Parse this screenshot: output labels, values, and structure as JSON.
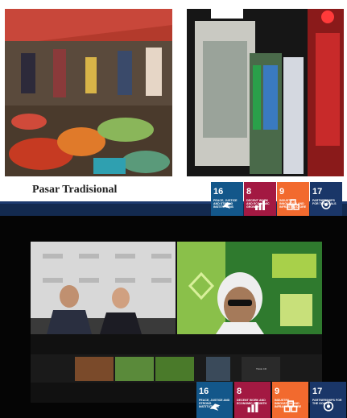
{
  "top_panel": {
    "caption": "Pasar Tradisional"
  },
  "sdg_badges": [
    {
      "number": "16",
      "label": "PEACE, JUSTICE AND STRONG INSTITUTIONS",
      "color": "#13578a",
      "icon": "dove-icon"
    },
    {
      "number": "8",
      "label": "DECENT WORK AND ECONOMIC GROWTH",
      "color": "#a31942",
      "icon": "growth-chart-icon"
    },
    {
      "number": "9",
      "label": "INDUSTRY, INNOVATION AND INFRASTRUCTURE",
      "color": "#f26a2e",
      "icon": "cubes-icon"
    },
    {
      "number": "17",
      "label": "PARTNERSHIPS FOR THE GOALS",
      "color": "#1a3668",
      "icon": "flower-icon"
    }
  ],
  "video_call": {
    "tile_label": "Tiktok CR"
  }
}
